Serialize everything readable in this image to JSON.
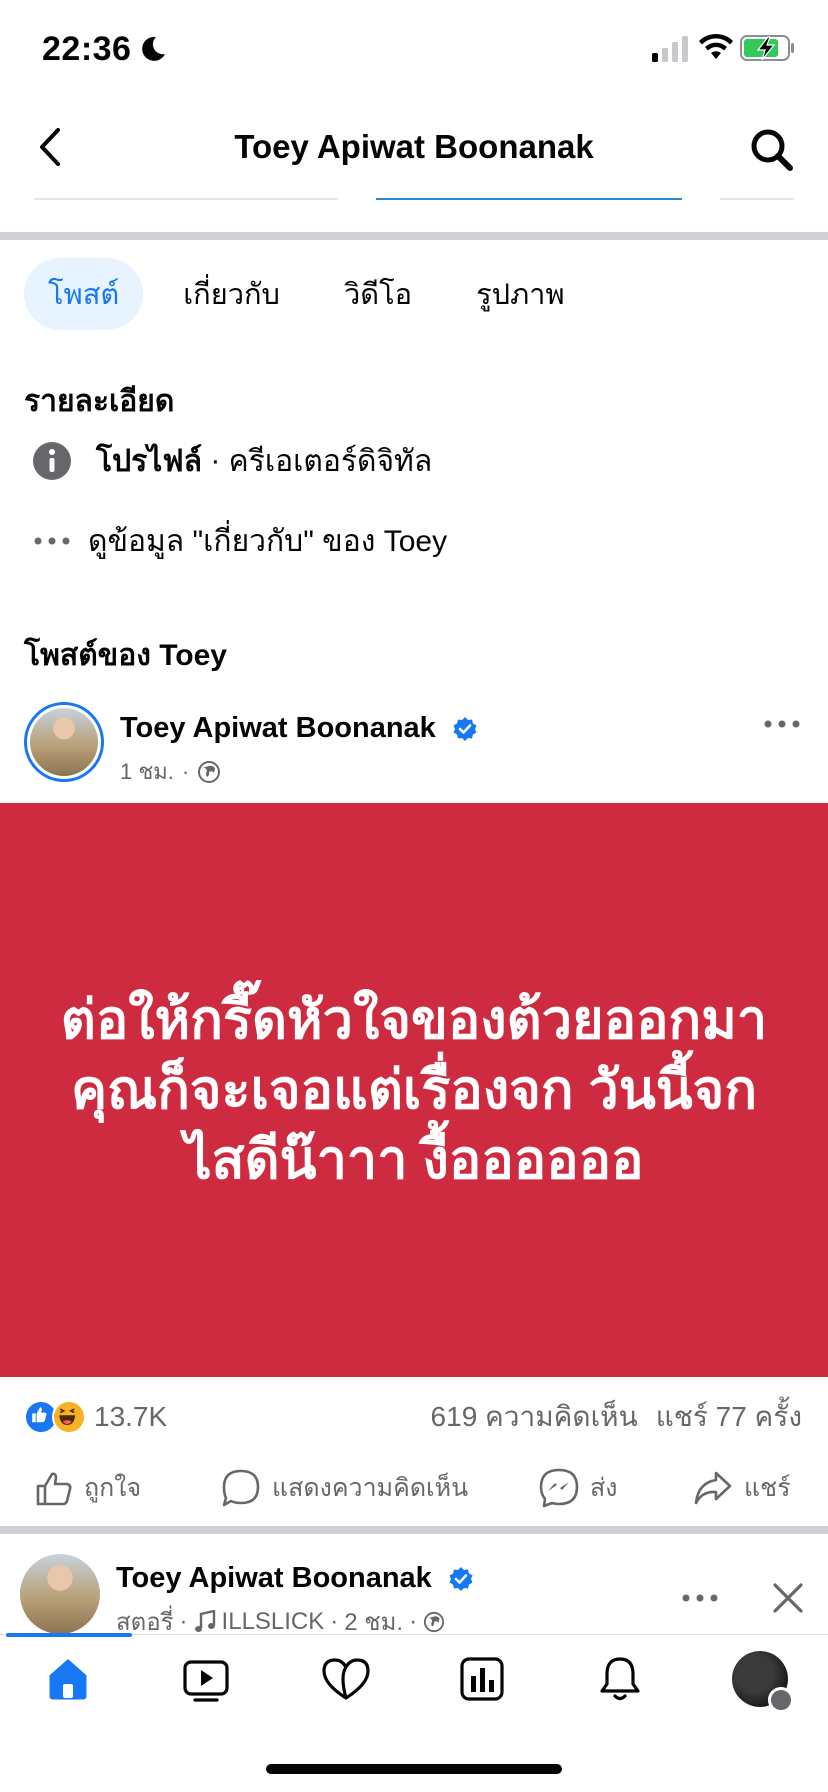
{
  "status_bar": {
    "time": "22:36",
    "moon_icon": "moon-icon",
    "signal_icon": "cellular-signal-icon",
    "wifi_icon": "wifi-icon",
    "battery_icon": "battery-charging-icon"
  },
  "header": {
    "title": "Toey Apiwat Boonanak",
    "back_icon": "chevron-left-icon",
    "search_icon": "search-icon"
  },
  "tabs": [
    {
      "label": "โพสต์",
      "active": true
    },
    {
      "label": "เกี่ยวกับ",
      "active": false
    },
    {
      "label": "วิดีโอ",
      "active": false
    },
    {
      "label": "รูปภาพ",
      "active": false
    }
  ],
  "details": {
    "title": "รายละเอียด",
    "profile_row": {
      "bold": "โปรไฟล์",
      "separator": " · ",
      "category": "ครีเอเตอร์ดิจิทัล",
      "icon": "info-icon"
    },
    "about_row": {
      "text": "ดูข้อมูล \"เกี่ยวกับ\" ของ Toey",
      "icon": "more-horizontal-icon"
    }
  },
  "posts_section": {
    "title": "โพสต์ของ Toey"
  },
  "post": {
    "author": "Toey Apiwat Boonanak",
    "verified_icon": "verified-badge-icon",
    "time": "1 ชม.",
    "dot": "·",
    "audience_icon": "globe-icon",
    "text": "ต่อให้กรี๊ดหัวใจของต้วยออกมา คุณก็จะเจอแต่เรื่องจก วันนี้จกไสดีน๊าาา งื้ออออออ",
    "background_color": "#cf2b40",
    "reactions_count": "13.7K",
    "reaction_icons": [
      "like-icon",
      "haha-icon"
    ],
    "comments": "619 ความคิดเห็น",
    "shares": "แชร์ 77 ครั้ง",
    "actions": {
      "like": "ถูกใจ",
      "comment": "แสดงความคิดเห็น",
      "send": "ส่ง",
      "share": "แชร์"
    }
  },
  "post2": {
    "author": "Toey Apiwat Boonanak",
    "type": "สตอรี่",
    "dot": "·",
    "music": "ILLSLICK",
    "time": "2 ชม.",
    "music_icon": "music-note-icon",
    "audience_icon": "globe-icon"
  },
  "tabbar": {
    "items": [
      "home-icon",
      "video-icon",
      "dating-heart-icon",
      "dashboard-icon",
      "notifications-bell-icon",
      "profile-menu-icon"
    ]
  },
  "colors": {
    "accent": "#1877f2",
    "post_card": "#cf2b40",
    "secondary_text": "#65676b"
  }
}
